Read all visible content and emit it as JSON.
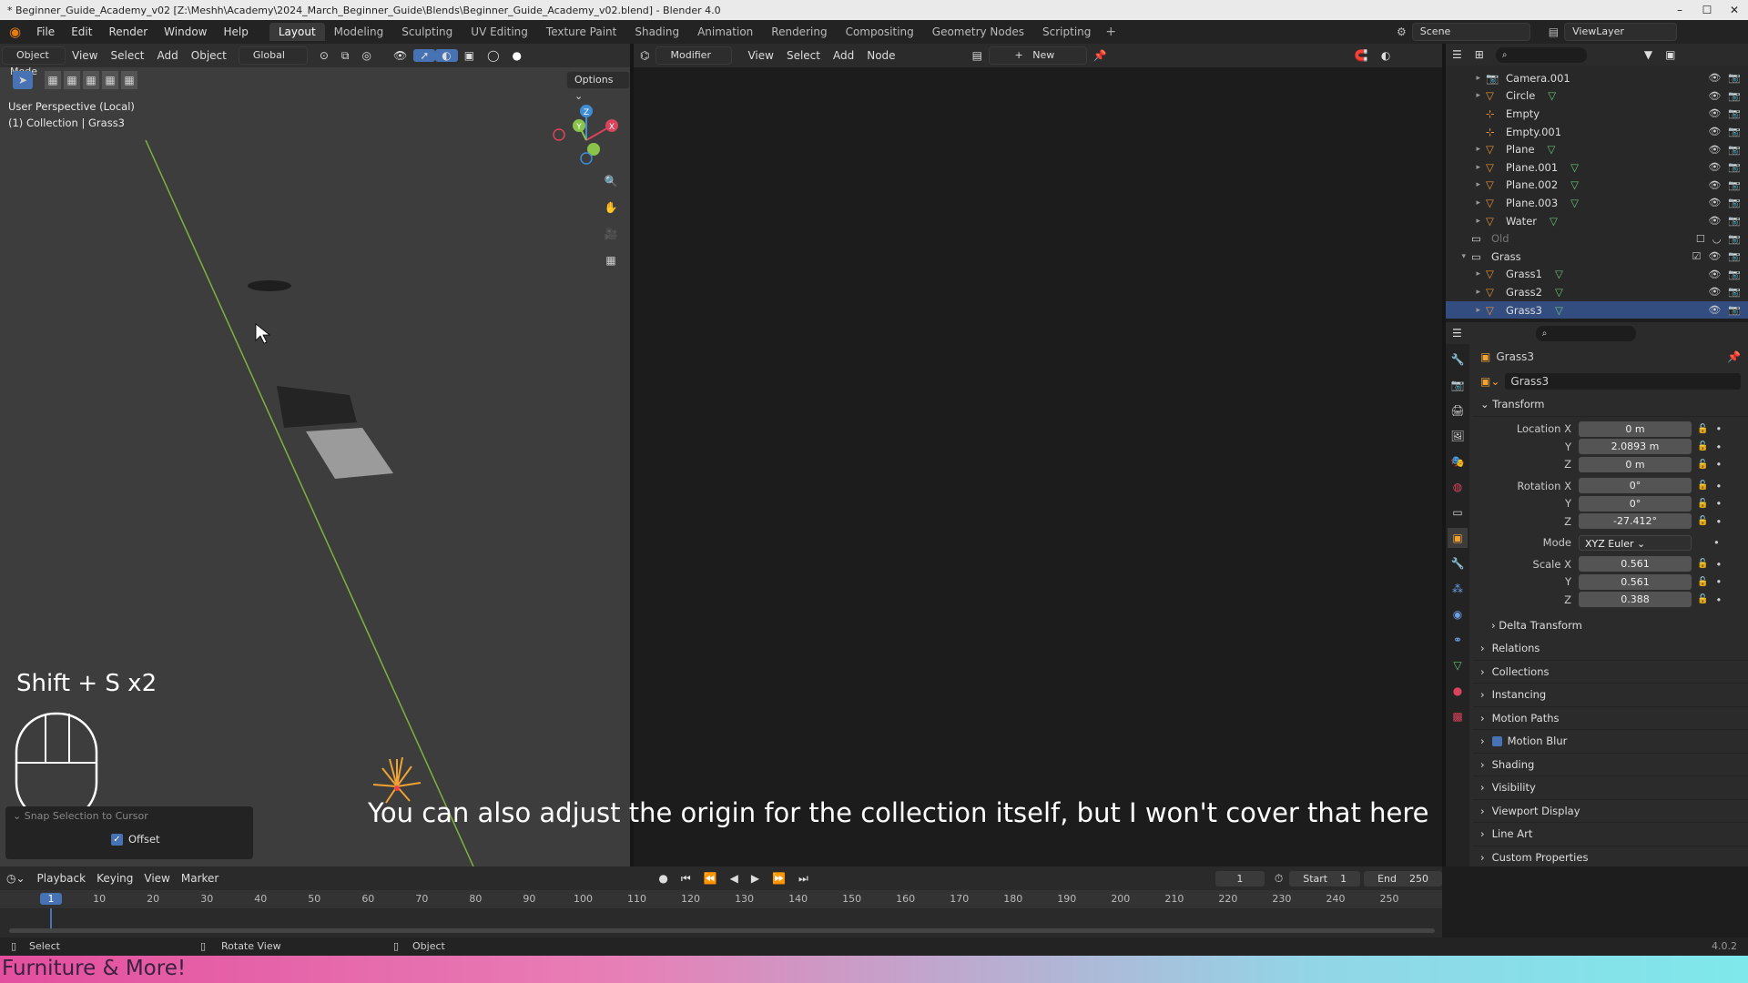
{
  "titlebar": {
    "title": "* Beginner_Guide_Academy_v02 [Z:\\Meshh\\Academy\\2024_March_Beginner_Guide\\Blends\\Beginner_Guide_Academy_v02.blend] - Blender 4.0",
    "minimize": "–",
    "maximize": "☐",
    "close": "✕"
  },
  "topbar": {
    "menu": [
      "File",
      "Edit",
      "Render",
      "Window",
      "Help"
    ],
    "workspaces": [
      "Layout",
      "Modeling",
      "Sculpting",
      "UV Editing",
      "Texture Paint",
      "Shading",
      "Animation",
      "Rendering",
      "Compositing",
      "Geometry Nodes",
      "Scripting"
    ],
    "add_workspace": "+",
    "scene_label": "Scene",
    "viewlayer_label": "ViewLayer"
  },
  "viewport": {
    "mode": "Object Mode",
    "menu": [
      "View",
      "Select",
      "Add",
      "Object"
    ],
    "transform_orientation": "Global",
    "options": "Options",
    "view_name": "User Perspective (Local)",
    "collection_info": "(1) Collection | Grass3",
    "shortcut_overlay": "Shift + S x2",
    "operator_panel_title": "Snap Selection to Cursor",
    "offset_label": "Offset",
    "offset_checked": true,
    "gizmo_axes": {
      "x": "X",
      "y": "Y",
      "z": "Z"
    }
  },
  "nodeeditor": {
    "type": "Modifier",
    "menu": [
      "View",
      "Select",
      "Add",
      "Node"
    ],
    "new_button": "New"
  },
  "caption": "You can also adjust the origin for the collection itself, but I won't cover that here",
  "outliner": {
    "items": [
      {
        "name": "Camera.001",
        "indent": 1,
        "kind": "camera",
        "dim": false
      },
      {
        "name": "Circle",
        "indent": 1,
        "kind": "mesh",
        "dim": false
      },
      {
        "name": "Empty",
        "indent": 1,
        "kind": "empty",
        "dim": false
      },
      {
        "name": "Empty.001",
        "indent": 1,
        "kind": "empty",
        "dim": false
      },
      {
        "name": "Plane",
        "indent": 1,
        "kind": "mesh",
        "dim": false
      },
      {
        "name": "Plane.001",
        "indent": 1,
        "kind": "mesh",
        "dim": false
      },
      {
        "name": "Plane.002",
        "indent": 1,
        "kind": "mesh",
        "dim": false
      },
      {
        "name": "Plane.003",
        "indent": 1,
        "kind": "mesh",
        "dim": false
      },
      {
        "name": "Water",
        "indent": 1,
        "kind": "mesh",
        "dim": false
      },
      {
        "name": "Old",
        "indent": 0,
        "kind": "collection",
        "dim": true
      },
      {
        "name": "Grass",
        "indent": 0,
        "kind": "collection",
        "dim": false
      },
      {
        "name": "Grass1",
        "indent": 1,
        "kind": "mesh",
        "dim": false
      },
      {
        "name": "Grass2",
        "indent": 1,
        "kind": "mesh",
        "dim": false
      },
      {
        "name": "Grass3",
        "indent": 1,
        "kind": "mesh",
        "dim": false
      }
    ]
  },
  "properties": {
    "object_name": "Grass3",
    "datablock_name": "Grass3",
    "transform_title": "Transform",
    "location_label": "Location X",
    "location": [
      "0 m",
      "2.0893 m",
      "0 m"
    ],
    "rotation_label": "Rotation X",
    "rotation": [
      "0°",
      "0°",
      "-27.412°"
    ],
    "mode_label": "Mode",
    "mode_value": "XYZ Euler",
    "scale_label": "Scale X",
    "scale": [
      "0.561",
      "0.561",
      "0.388"
    ],
    "y_label": "Y",
    "z_label": "Z",
    "delta_transform": "Delta Transform",
    "panels": [
      "Relations",
      "Collections",
      "Instancing",
      "Motion Paths",
      "Motion Blur",
      "Shading",
      "Visibility",
      "Viewport Display",
      "Line Art",
      "Custom Properties"
    ]
  },
  "timeline": {
    "menu": [
      "Playback",
      "Keying",
      "View",
      "Marker"
    ],
    "current_frame": "1",
    "start_label": "Start",
    "start_value": "1",
    "end_label": "End",
    "end_value": "250",
    "ticks": [
      "1",
      "10",
      "20",
      "30",
      "40",
      "50",
      "60",
      "70",
      "80",
      "90",
      "100",
      "110",
      "120",
      "130",
      "140",
      "150",
      "160",
      "170",
      "180",
      "190",
      "200",
      "210",
      "220",
      "230",
      "240",
      "250"
    ]
  },
  "statusbar": {
    "select": "Select",
    "rotate_view": "Rotate View",
    "object": "Object",
    "version": "4.0.2"
  },
  "banner_text": "Furniture & More!",
  "colors": {
    "accent": "#4772b3",
    "selected_row": "#334d80",
    "object_orange": "#e7943a",
    "mesh_green": "#6bc17a",
    "axis_x": "#d9435c",
    "axis_y": "#8bc34a",
    "axis_z": "#3f8dd6"
  }
}
